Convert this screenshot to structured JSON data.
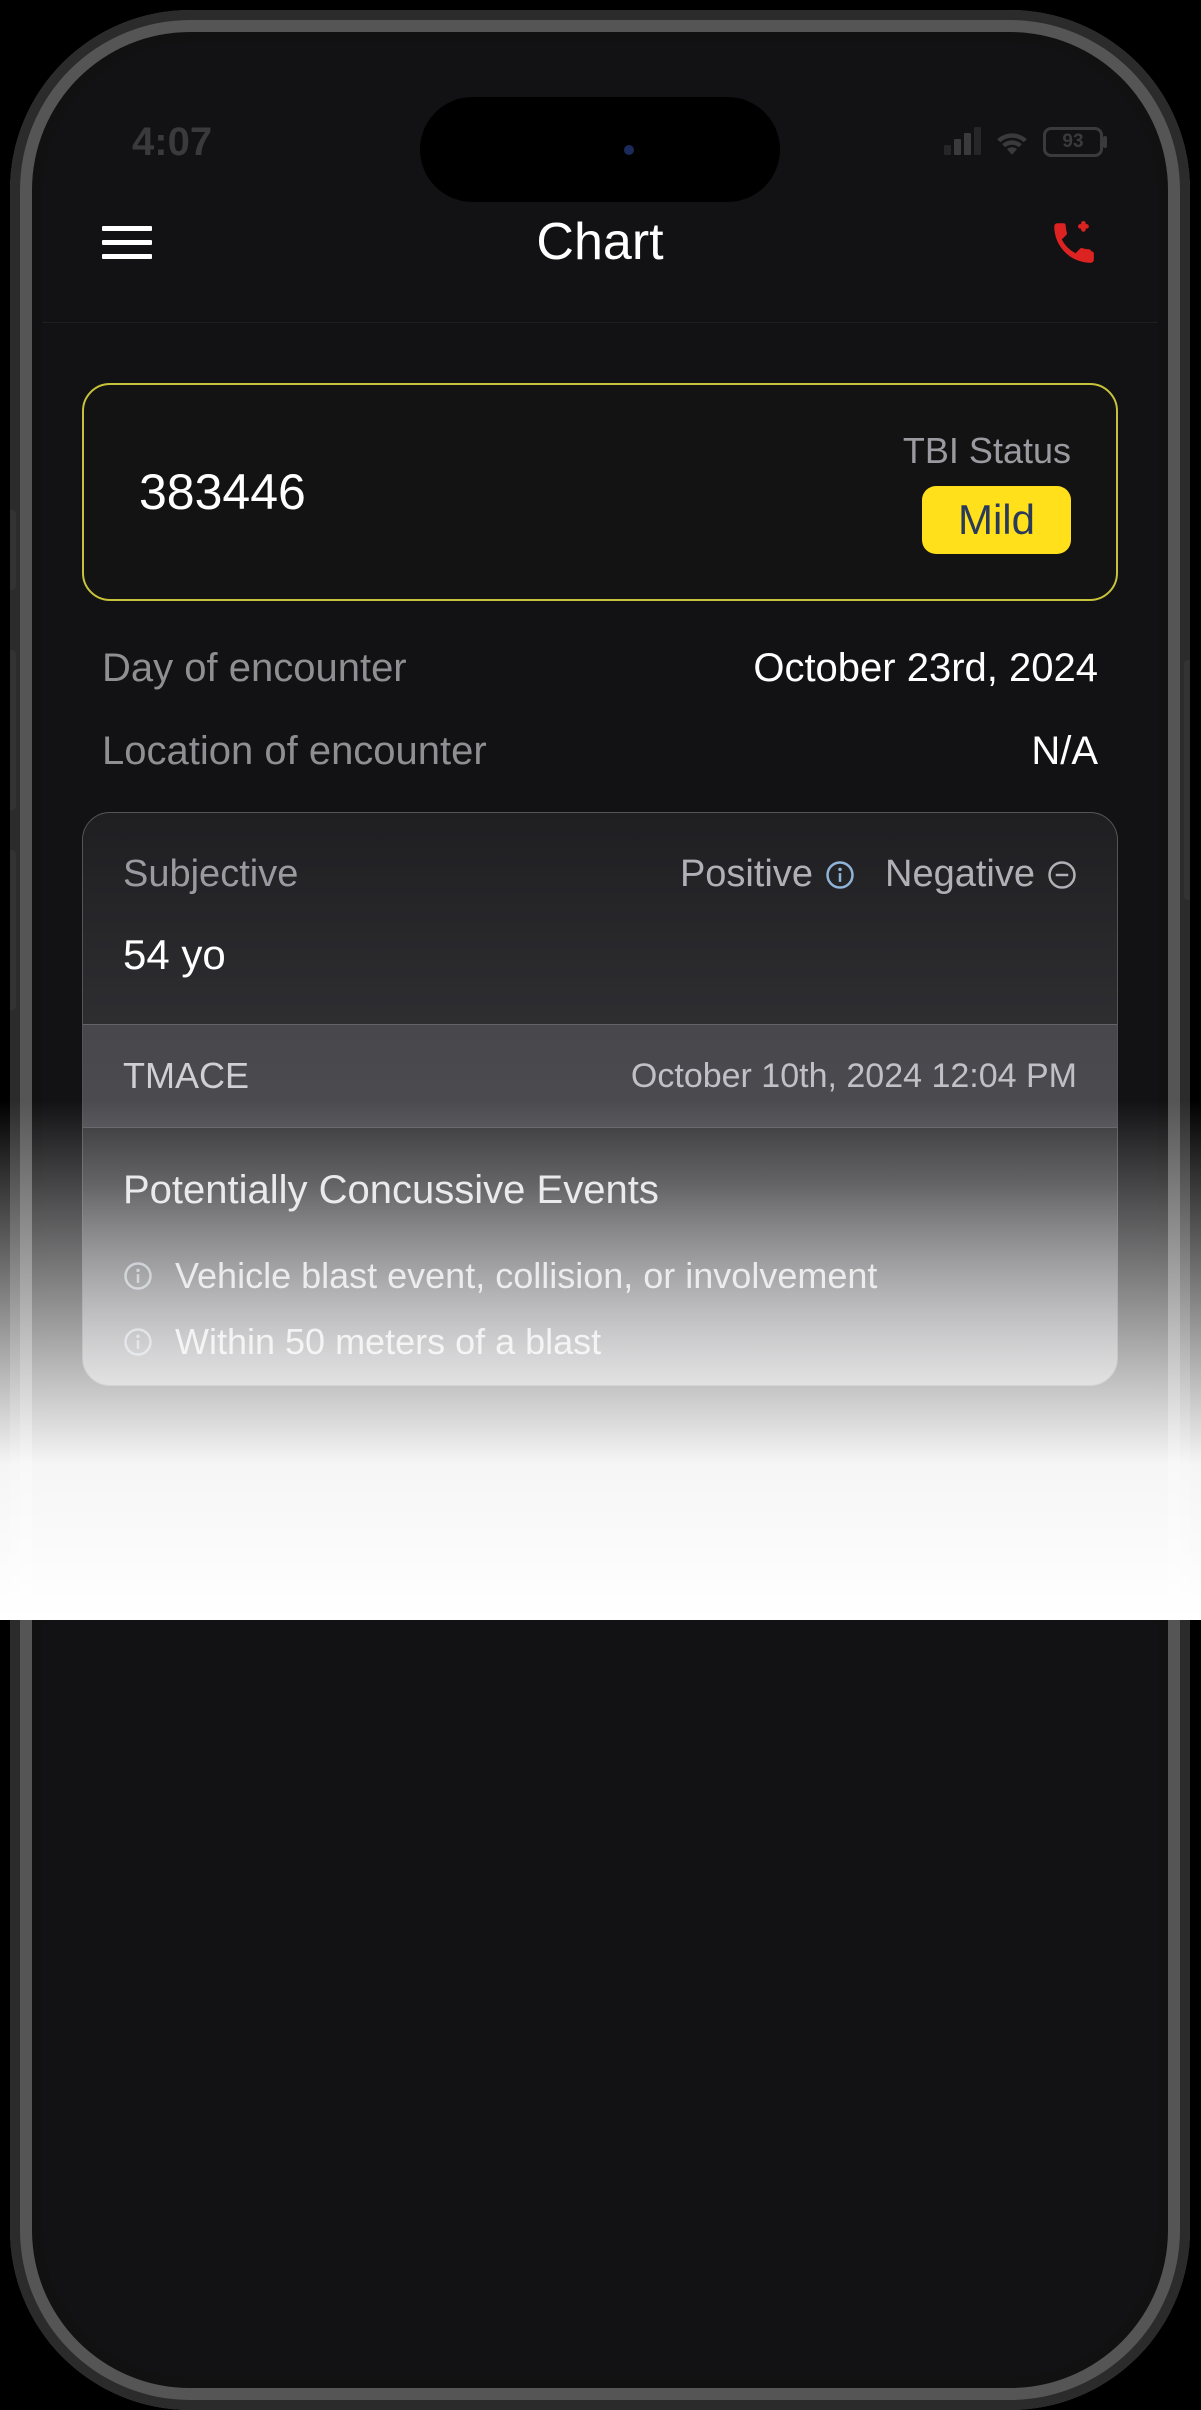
{
  "statusbar": {
    "time": "4:07",
    "battery_pct": "93"
  },
  "appbar": {
    "title": "Chart"
  },
  "patient": {
    "id": "383446",
    "tbi_label": "TBI Status",
    "tbi_value": "Mild"
  },
  "encounter": {
    "day_label": "Day of encounter",
    "day_value": "October 23rd, 2024",
    "location_label": "Location of encounter",
    "location_value": "N/A"
  },
  "subjective": {
    "title": "Subjective",
    "positive": "Positive",
    "negative": "Negative",
    "body": "54 yo"
  },
  "tmace": {
    "label": "TMACE",
    "timestamp": "October 10th, 2024 12:04 PM"
  },
  "pce": {
    "title": "Potentially Concussive Events",
    "items": [
      "Vehicle blast event, collision, or involvement",
      "Within 50 meters of a blast"
    ]
  }
}
